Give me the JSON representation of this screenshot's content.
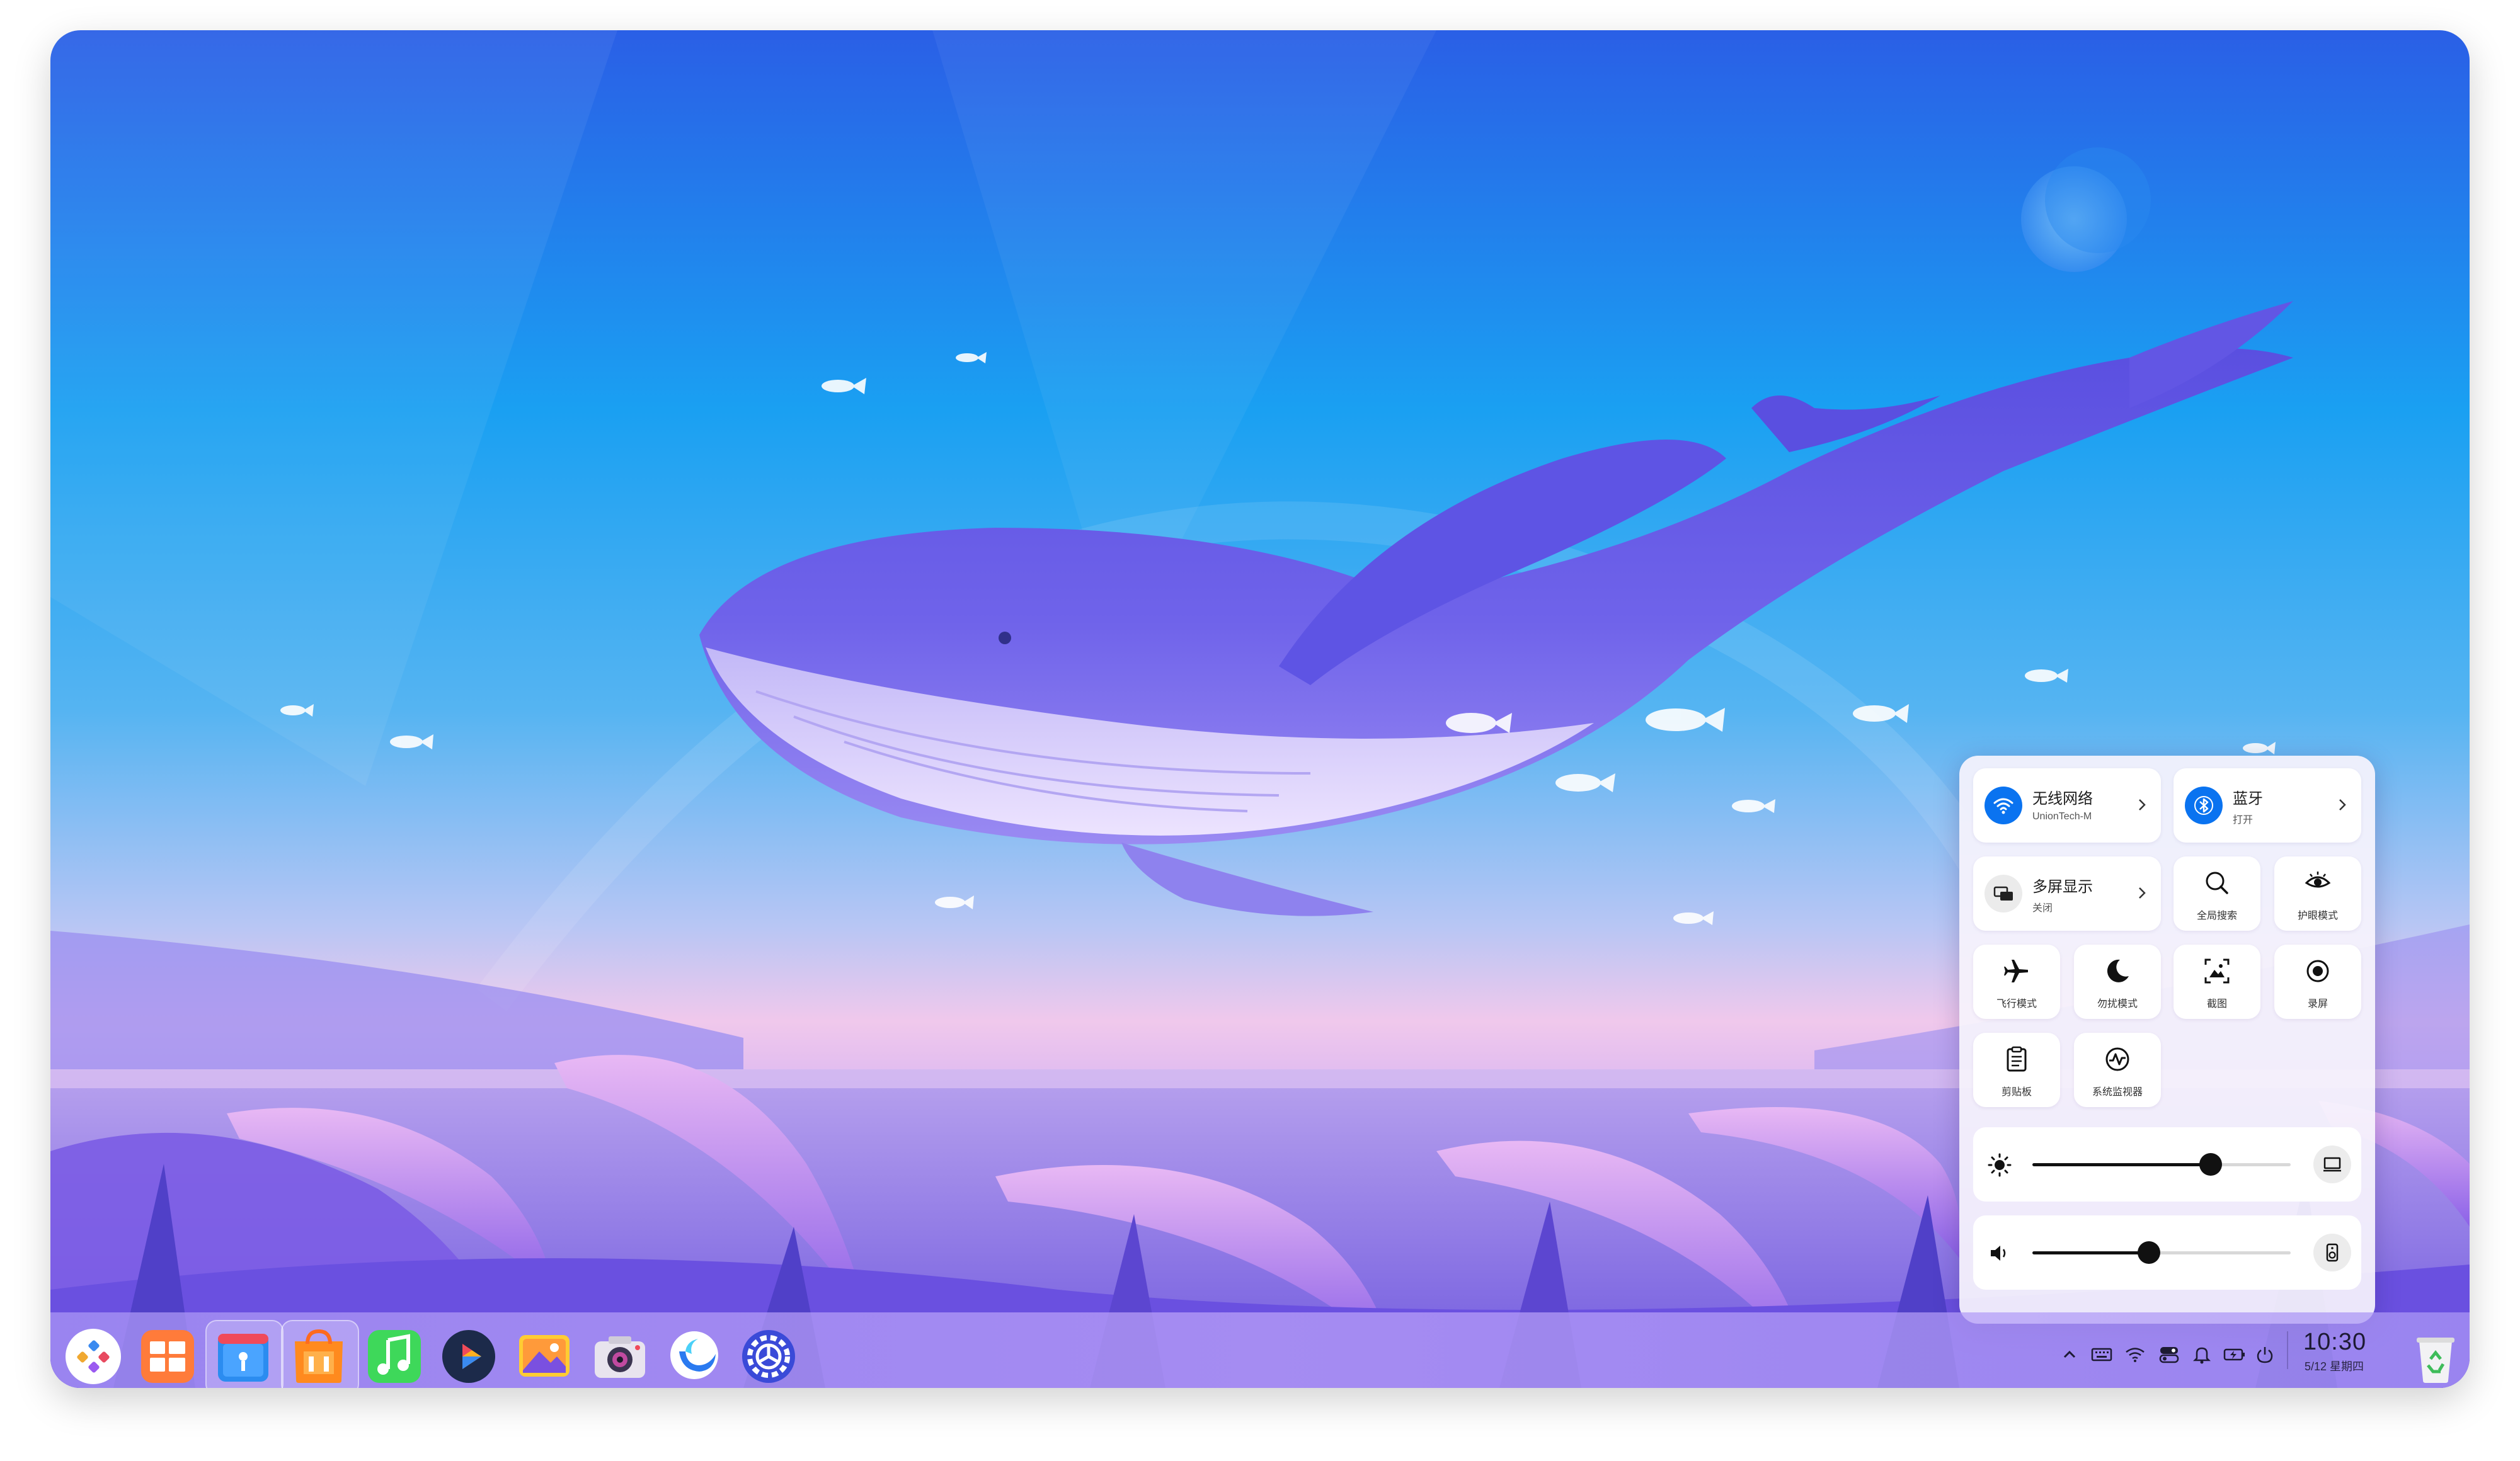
{
  "control_center": {
    "wifi": {
      "title": "无线网络",
      "subtitle": "UnionTech-M",
      "icon": "wifi-icon"
    },
    "bluetooth": {
      "title": "蓝牙",
      "subtitle": "打开",
      "icon": "bluetooth-icon"
    },
    "multi_display": {
      "title": "多屏显示",
      "subtitle": "关闭",
      "icon": "multi-display-icon"
    },
    "global_search": {
      "label": "全局搜索",
      "icon": "search-icon"
    },
    "eye_care": {
      "label": "护眼模式",
      "icon": "eye-icon"
    },
    "airplane": {
      "label": "飞行模式",
      "icon": "airplane-icon"
    },
    "dnd": {
      "label": "勿扰模式",
      "icon": "moon-icon"
    },
    "screenshot": {
      "label": "截图",
      "icon": "screenshot-icon"
    },
    "screen_record": {
      "label": "录屏",
      "icon": "record-icon"
    },
    "clipboard": {
      "label": "剪贴板",
      "icon": "clipboard-icon"
    },
    "system_monitor": {
      "label": "系统监视器",
      "icon": "system-monitor-icon"
    },
    "brightness": {
      "level": 0.69,
      "icon": "sun-icon",
      "device_icon": "display-icon"
    },
    "volume": {
      "level": 0.45,
      "icon": "speaker-icon",
      "device_icon": "speaker-device-icon"
    }
  },
  "dock": {
    "apps": [
      "launcher-icon",
      "multitask-view-icon",
      "file-manager-icon",
      "app-store-icon",
      "music-icon",
      "video-player-icon",
      "image-viewer-icon",
      "camera-icon",
      "browser-icon",
      "settings-icon"
    ],
    "active_app": "browser-icon"
  },
  "tray": {
    "icons": [
      "chevron-up-icon",
      "keyboard-icon",
      "wifi-icon",
      "toggle-icon",
      "bell-icon",
      "battery-icon",
      "power-icon"
    ],
    "time": "10:30",
    "date": "5/12 星期四",
    "trash_icon": "trash-icon"
  },
  "colors": {
    "accent": "#0a73f0",
    "sky_top": "#2a67e8",
    "sky_mid": "#1ea2f0",
    "horizon": "#f0c6ea",
    "grass": "#6a52e0"
  }
}
